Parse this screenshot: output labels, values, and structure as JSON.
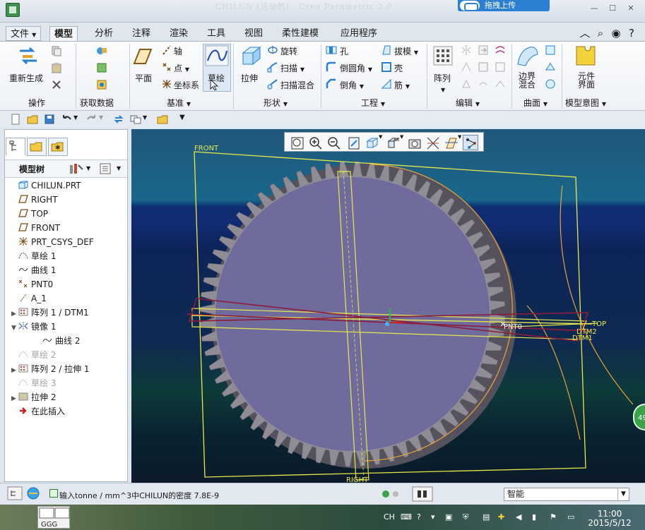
{
  "window": {
    "title": "CHILUN (活动的) - Creo Parametric 2.0",
    "upload_label": "拖拽上传",
    "controls": [
      "—",
      "☐",
      "✕"
    ]
  },
  "tabs": [
    {
      "label": "文件",
      "has_arrow": true
    },
    {
      "label": "模型",
      "active": true
    },
    {
      "label": "分析"
    },
    {
      "label": "注释"
    },
    {
      "label": "渲染"
    },
    {
      "label": "工具"
    },
    {
      "label": "视图"
    },
    {
      "label": "柔性建模"
    },
    {
      "label": "应用程序"
    }
  ],
  "ribbon": {
    "regenerate": "重新生成",
    "plane": "平面",
    "axis": "轴",
    "point": "点",
    "csys": "坐标系",
    "sketch": "草绘",
    "extrude": "拉伸",
    "revolve": "旋转",
    "sweep": "扫描",
    "swept_blend": "扫描混合",
    "hole": "孔",
    "round": "倒圆角",
    "chamfer": "倒角",
    "draft": "拔模",
    "shell": "壳",
    "rib": "筋",
    "pattern": "阵列",
    "boundary_blend_1": "边界",
    "boundary_blend_2": "混合",
    "component_interface_1": "元件",
    "component_interface_2": "界面"
  },
  "groups": [
    "操作",
    "获取数据",
    "基准",
    "形状",
    "工程",
    "编辑",
    "曲面",
    "模型意图"
  ],
  "model_tree": {
    "title": "模型树",
    "items": [
      {
        "label": "CHILUN.PRT",
        "icon": "part-icon",
        "expander": ""
      },
      {
        "label": "RIGHT",
        "icon": "datum-plane-icon",
        "expander": ""
      },
      {
        "label": "TOP",
        "icon": "datum-plane-icon",
        "expander": ""
      },
      {
        "label": "FRONT",
        "icon": "datum-plane-icon",
        "expander": ""
      },
      {
        "label": "PRT_CSYS_DEF",
        "icon": "csys-icon",
        "expander": ""
      },
      {
        "label": "草绘 1",
        "icon": "sketch-icon",
        "expander": ""
      },
      {
        "label": "曲线 1",
        "icon": "curve-icon",
        "expander": ""
      },
      {
        "label": "PNT0",
        "icon": "point-icon",
        "expander": ""
      },
      {
        "label": "A_1",
        "icon": "axis-icon",
        "expander": ""
      },
      {
        "label": "阵列 1 / DTM1",
        "icon": "pattern-icon",
        "expander": "▶"
      },
      {
        "label": "镜像 1",
        "icon": "mirror-icon",
        "expander": "▼"
      },
      {
        "label": "曲线 2",
        "icon": "curve-icon",
        "expander": "",
        "indent": true
      },
      {
        "label": "草绘 2",
        "icon": "sketch-icon",
        "expander": "",
        "muted": true
      },
      {
        "label": "阵列 2 / 拉伸 1",
        "icon": "pattern-icon",
        "expander": "▶"
      },
      {
        "label": "草绘 3",
        "icon": "sketch-icon",
        "expander": "",
        "muted": true
      },
      {
        "label": "拉伸 2",
        "icon": "extrude-icon",
        "expander": "▶"
      },
      {
        "label": "在此插入",
        "icon": "insert-here-icon",
        "expander": ""
      }
    ]
  },
  "viewport": {
    "labels": {
      "front": "FRONT",
      "right": "RIGHT",
      "top": "TOP",
      "dtm2": "DTM2",
      "dtm1": "DTM1",
      "pnt0": "PNT0"
    },
    "teeth": 64,
    "colors": {
      "gear_face": "#6f6b9d",
      "gear_teeth": "#8f8c96",
      "datum_yellow": "#e9e84a",
      "curve_orange": "#e8a23a"
    }
  },
  "status": {
    "message": "输入tonne / mm^3中CHILUN的密度  7.8E-9",
    "filter_value": "智能"
  },
  "taskbar": {
    "ime": "CH",
    "time": "11:00",
    "date": "2015/5/12",
    "side_badge": "49"
  }
}
